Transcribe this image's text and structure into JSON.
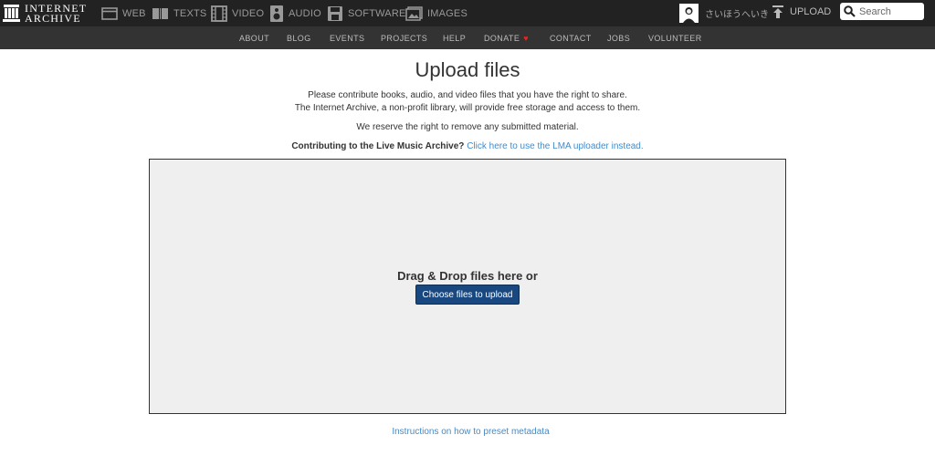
{
  "header": {
    "logo_line1": "INTERNET",
    "logo_line2": "ARCHIVE",
    "media": {
      "web": "WEB",
      "texts": "TEXTS",
      "video": "VIDEO",
      "audio": "AUDIO",
      "software": "SOFTWARE",
      "images": "IMAGES"
    },
    "user_name": "さいほうへいき",
    "upload": "UPLOAD",
    "search_placeholder": "Search"
  },
  "subnav": {
    "about": "ABOUT",
    "blog": "BLOG",
    "events": "EVENTS",
    "projects": "PROJECTS",
    "help": "HELP",
    "donate": "DONATE",
    "contact": "CONTACT",
    "jobs": "JOBS",
    "volunteer": "VOLUNTEER"
  },
  "main": {
    "title": "Upload files",
    "intro_line1": "Please contribute books, audio, and video files that you have the right to share.",
    "intro_line2": "The Internet Archive, a non-profit library, will provide free storage and access to them.",
    "reserve": "We reserve the right to remove any submitted material.",
    "lma_question": "Contributing to the Live Music Archive?",
    "lma_link": "Click here to use the LMA uploader instead.",
    "drop_label": "Drag & Drop files here or",
    "choose_button": "Choose files to upload",
    "instructions_link": "Instructions on how to preset metadata"
  },
  "colors": {
    "topbar": "#222222",
    "subnav": "#333333",
    "link": "#428bca",
    "button": "#194880",
    "dropzone": "#efefef",
    "heart": "#ee2222"
  },
  "icons": [
    "archive-logo-icon",
    "web-icon",
    "texts-icon",
    "video-icon",
    "audio-icon",
    "software-icon",
    "images-icon",
    "upload-arrow-icon",
    "search-icon",
    "heart-icon"
  ]
}
